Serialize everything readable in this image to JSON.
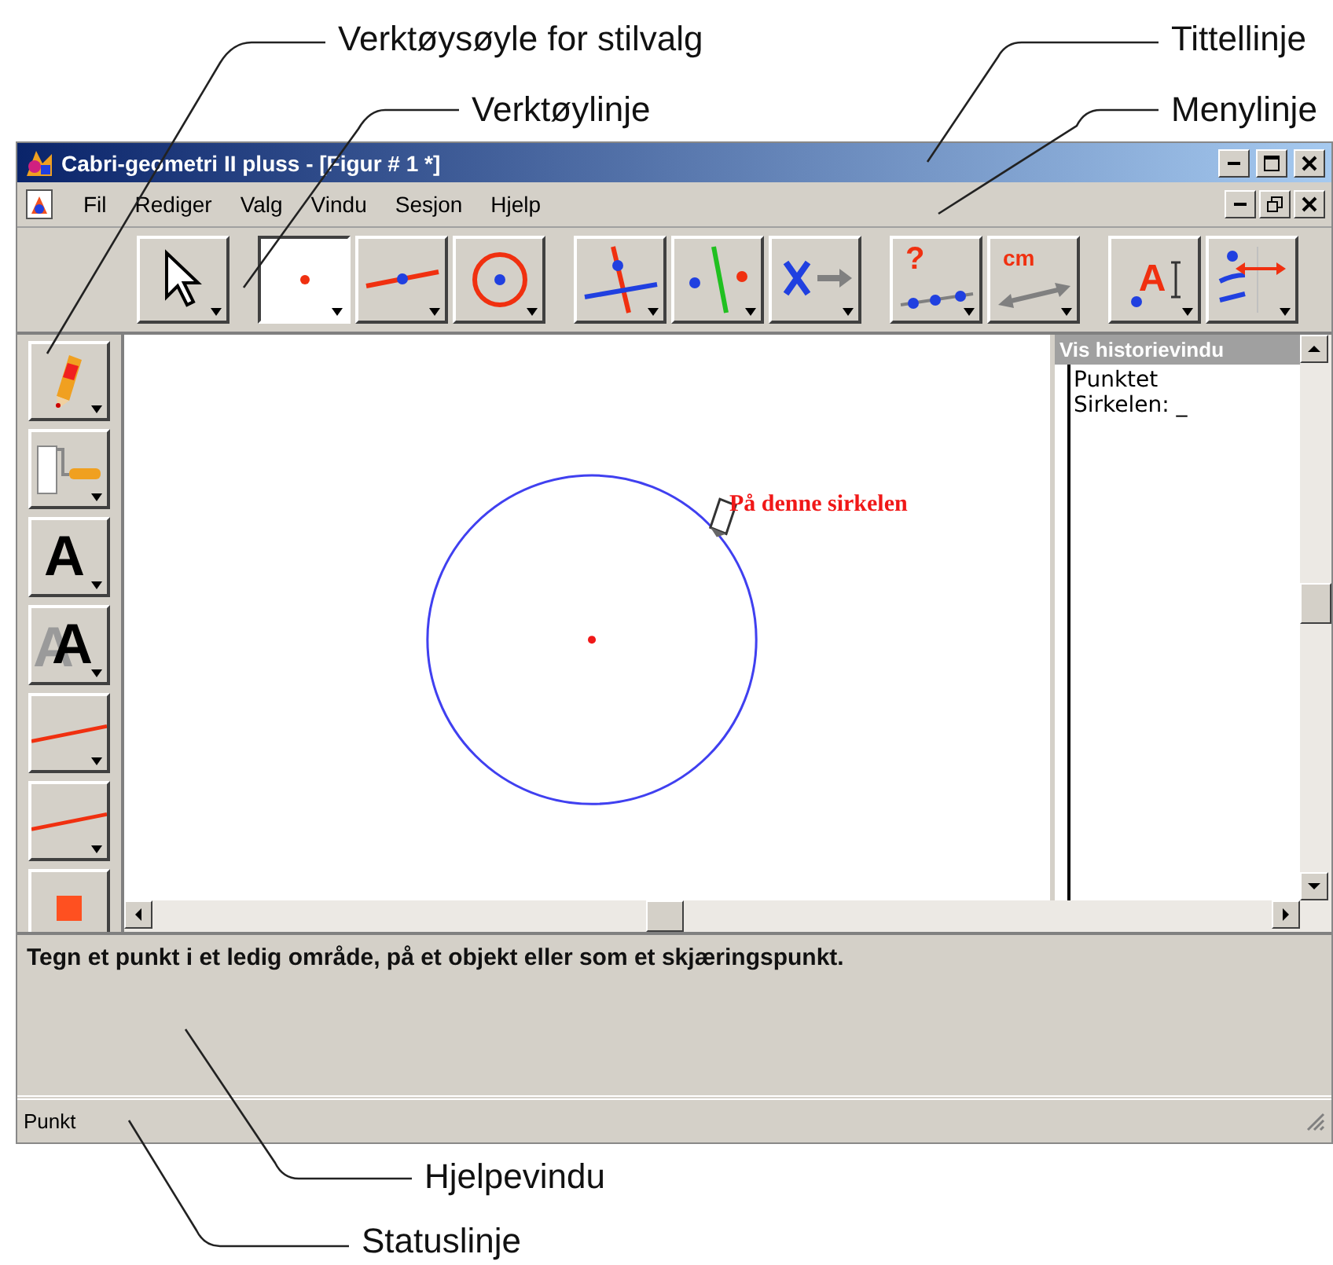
{
  "callouts_top": [
    {
      "label": "Verktøysøyle for stilvalg"
    },
    {
      "label": "Tittellinje"
    },
    {
      "label": "Verktøylinje"
    },
    {
      "label": "Menylinje"
    }
  ],
  "window": {
    "title": "Cabri-geometri II pluss - [Figur # 1 *]"
  },
  "menu": [
    "Fil",
    "Rediger",
    "Valg",
    "Vindu",
    "Sesjon",
    "Hjelp"
  ],
  "toolbar": [
    [
      {
        "kind": "pointer",
        "selected": false
      }
    ],
    [
      {
        "kind": "point",
        "selected": true
      },
      {
        "kind": "line",
        "selected": false
      },
      {
        "kind": "circle",
        "selected": false
      }
    ],
    [
      {
        "kind": "perpendicular",
        "selected": false
      },
      {
        "kind": "symmetry",
        "selected": false
      },
      {
        "kind": "transform",
        "selected": false
      }
    ],
    [
      {
        "kind": "collinear",
        "selected": false,
        "label": "?"
      },
      {
        "kind": "measure",
        "selected": false,
        "label": "cm"
      }
    ],
    [
      {
        "kind": "text",
        "selected": false,
        "label": "A"
      },
      {
        "kind": "attributes",
        "selected": false
      }
    ]
  ],
  "style_tools": [
    {
      "kind": "pencil"
    },
    {
      "kind": "fill"
    },
    {
      "kind": "text-size",
      "label": "A"
    },
    {
      "kind": "text-style",
      "label": "A"
    },
    {
      "kind": "thickness"
    },
    {
      "kind": "dashing"
    },
    {
      "kind": "color"
    }
  ],
  "canvas": {
    "hint": "På denne sirkelen"
  },
  "history": {
    "title": "Vis historievindu",
    "lines": [
      "Punktet",
      "Sirkelen: _"
    ]
  },
  "help": "Tegn et punkt i et ledig område, på et objekt eller som et skjæringspunkt.",
  "status": "Punkt",
  "callouts_bottom": [
    {
      "label": "Hjelpevindu"
    },
    {
      "label": "Statuslinje"
    }
  ]
}
